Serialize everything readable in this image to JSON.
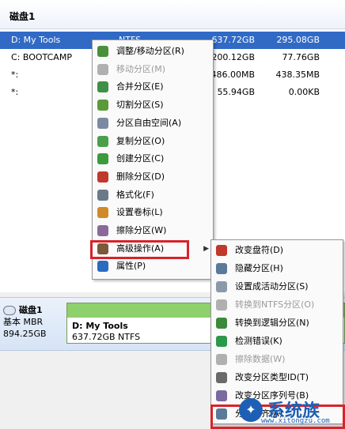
{
  "header": {
    "title": "磁盘1"
  },
  "partitions": [
    {
      "name": "D: My Tools",
      "fs": "NTFS",
      "capacity": "637.72GB",
      "free": "295.08GB"
    },
    {
      "name": "C: BOOTCAMP",
      "fs": "",
      "capacity": "200.12GB",
      "free": "77.76GB"
    },
    {
      "name": "*:",
      "fs": "",
      "capacity": "486.00MB",
      "free": "438.35MB"
    },
    {
      "name": "*:",
      "fs": "",
      "capacity": "55.94GB",
      "free": "0.00KB"
    }
  ],
  "diskmap": {
    "disk_name": "磁盘1",
    "disk_type": "基本 MBR",
    "disk_size": "894.25GB",
    "partition_name": "D: My Tools",
    "partition_info": "637.72GB NTFS"
  },
  "context_menu": {
    "items": [
      {
        "label": "调整/移动分区(R)",
        "icon": "resize-icon",
        "color": "#4a8f3a",
        "disabled": false
      },
      {
        "label": "移动分区(M)",
        "icon": "move-icon",
        "color": "#b0b0b0",
        "disabled": true
      },
      {
        "label": "合并分区(E)",
        "icon": "merge-icon",
        "color": "#3f8f46",
        "disabled": false
      },
      {
        "label": "切割分区(S)",
        "icon": "split-icon",
        "color": "#5a9a3a",
        "disabled": false
      },
      {
        "label": "分区自由空间(A)",
        "icon": "free-space-icon",
        "color": "#7a8aa0",
        "disabled": false
      },
      {
        "label": "复制分区(O)",
        "icon": "copy-icon",
        "color": "#4aa04a",
        "disabled": false
      },
      {
        "label": "创建分区(C)",
        "icon": "create-icon",
        "color": "#3c9a3c",
        "disabled": false
      },
      {
        "label": "删除分区(D)",
        "icon": "delete-icon",
        "color": "#c0392b",
        "disabled": false
      },
      {
        "label": "格式化(F)",
        "icon": "format-icon",
        "color": "#6a7a8a",
        "disabled": false
      },
      {
        "label": "设置卷标(L)",
        "icon": "label-icon",
        "color": "#d08a2a",
        "disabled": false
      },
      {
        "label": "擦除分区(W)",
        "icon": "wipe-icon",
        "color": "#8a6a9a",
        "disabled": false
      },
      {
        "label": "高级操作(A)",
        "icon": "advanced-icon",
        "color": "#7a5a3a",
        "disabled": false
      },
      {
        "label": "属性(P)",
        "icon": "info-icon",
        "color": "#2a6ac0",
        "disabled": false
      }
    ]
  },
  "submenu": {
    "items": [
      {
        "label": "改变盘符(D)",
        "icon": "drive-letter-icon",
        "color": "#c0392b",
        "disabled": false
      },
      {
        "label": "隐藏分区(H)",
        "icon": "hide-icon",
        "color": "#5a7a9a",
        "disabled": false
      },
      {
        "label": "设置成活动分区(S)",
        "icon": "active-icon",
        "color": "#8a9aaa",
        "disabled": false
      },
      {
        "label": "转换到NTFS分区(O)",
        "icon": "convert-ntfs-icon",
        "color": "#b0b0b0",
        "disabled": true
      },
      {
        "label": "转换到逻辑分区(N)",
        "icon": "convert-logical-icon",
        "color": "#3a8a3a",
        "disabled": false
      },
      {
        "label": "检测错误(K)",
        "icon": "check-icon",
        "color": "#2a9a4a",
        "disabled": false
      },
      {
        "label": "擦除数据(W)",
        "icon": "wipe-data-icon",
        "color": "#b0b0b0",
        "disabled": true
      },
      {
        "label": "改变分区类型ID(T)",
        "icon": "type-id-icon",
        "color": "#6a6a6a",
        "disabled": false
      },
      {
        "label": "改变分区序列号(B)",
        "icon": "serial-icon",
        "color": "#7a6aa0",
        "disabled": false
      },
      {
        "label": "分区对齐(A)",
        "icon": "align-icon",
        "color": "#5a7a9a",
        "disabled": false
      }
    ]
  },
  "watermark": {
    "text": "系统族",
    "url": "www.xitongzu.com"
  }
}
